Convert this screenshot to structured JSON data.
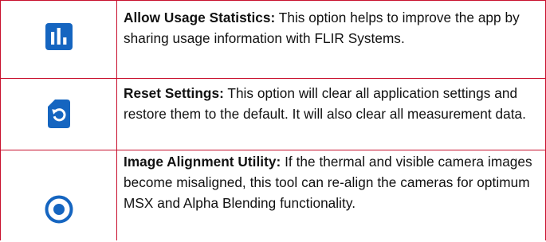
{
  "colors": {
    "icon_blue": "#1565c0",
    "border_red": "#c8102e"
  },
  "rows": [
    {
      "icon": "bar-chart-icon",
      "term": "Allow Usage Statistics:",
      "description": " This option helps to improve the app by sharing usage information with FLIR Systems."
    },
    {
      "icon": "reset-sd-card-icon",
      "term": "Reset Settings:",
      "description": " This option will clear all application settings and restore them to the default. It will also clear all measurement data."
    },
    {
      "icon": "target-alignment-icon",
      "term": "Image Alignment Utility:",
      "description": " If the thermal and visible camera images become misaligned, this tool can re-align the cameras for optimum MSX and Alpha Blending functionality."
    }
  ]
}
